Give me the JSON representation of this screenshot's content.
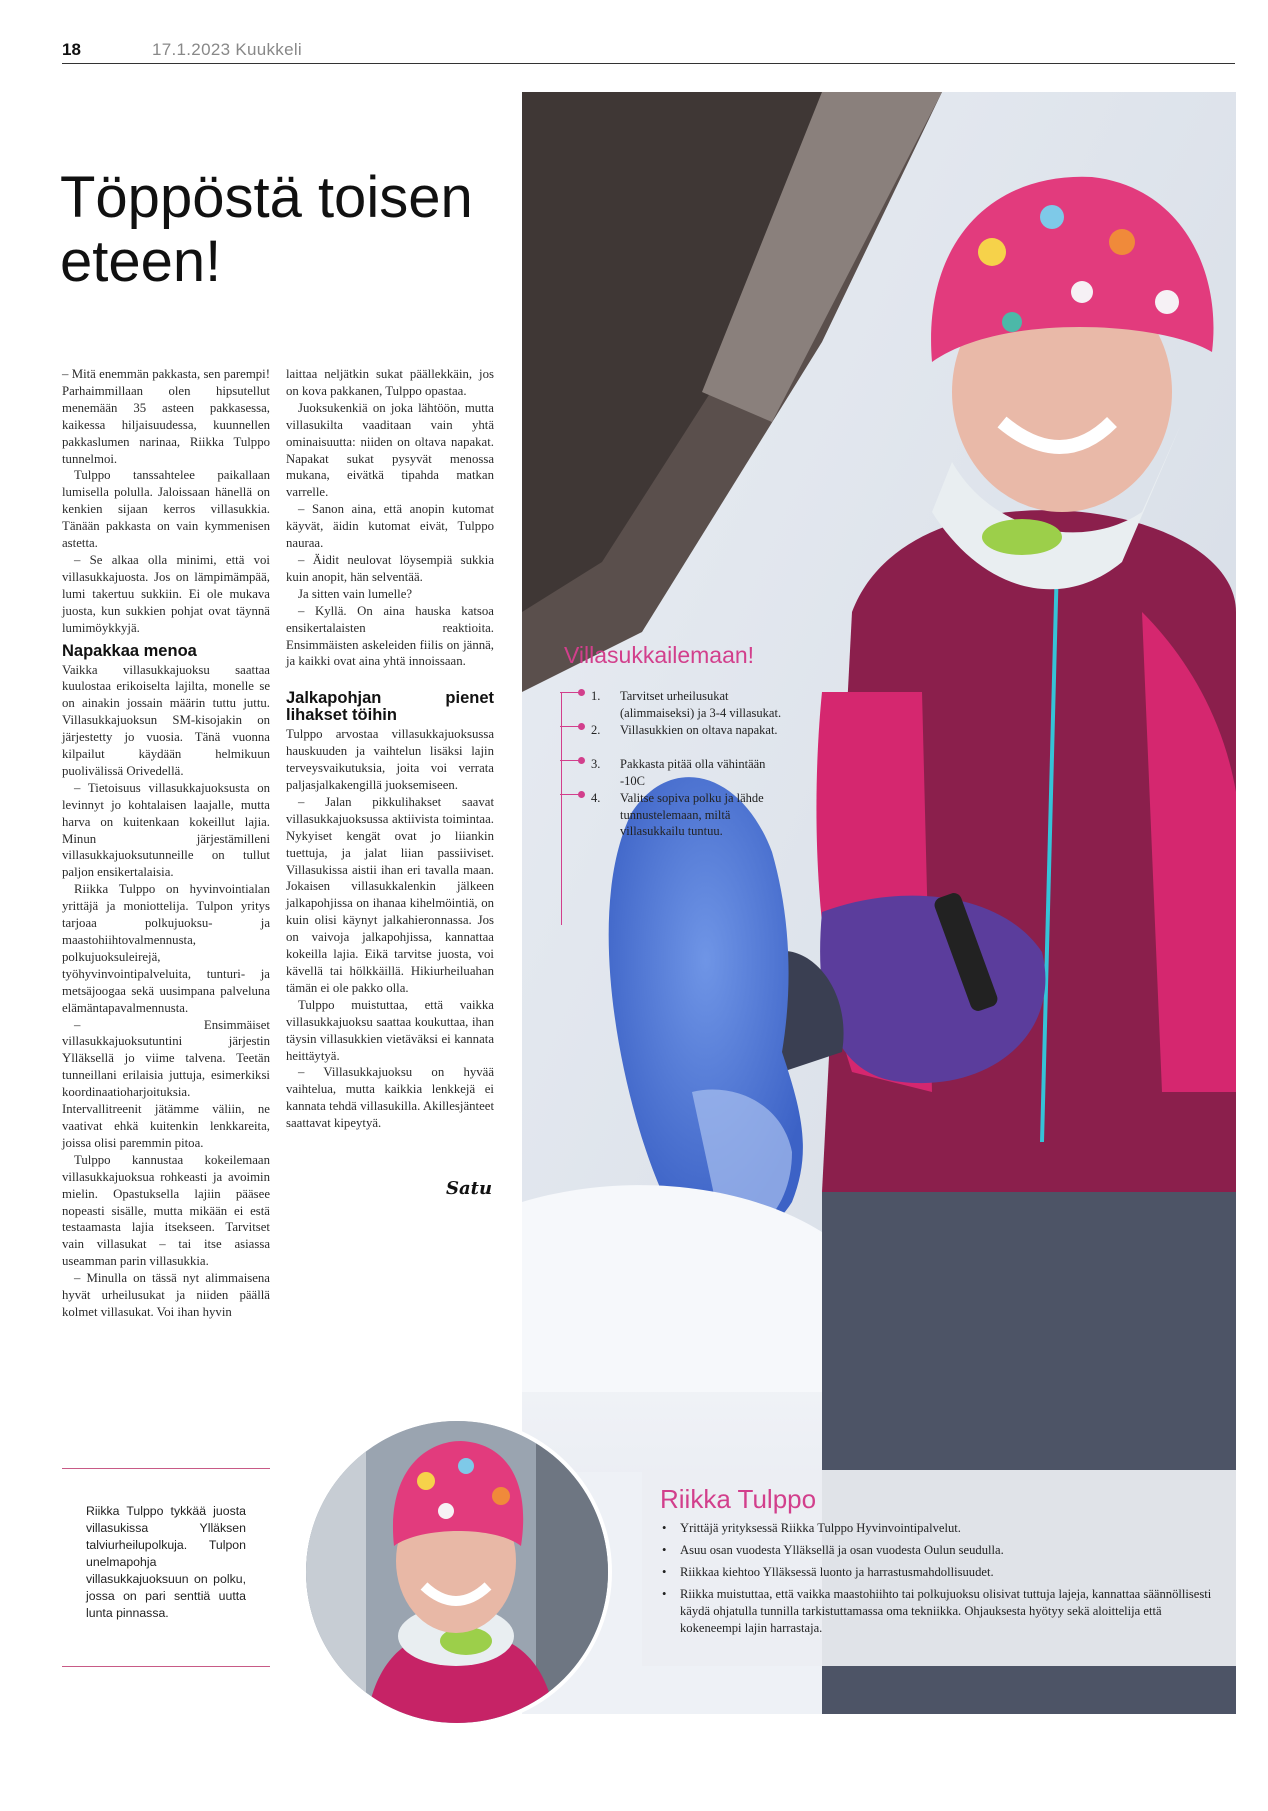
{
  "header": {
    "page_number": "18",
    "issue": "17.1.2023 Kuukkeli"
  },
  "title": "Töppöstä toisen eteen!",
  "col1": {
    "p1": "– Mitä enemmän pakkasta, sen parempi! Parhaimmillaan olen hipsutellut menemään 35 asteen pakkasessa, kaikessa hiljaisuudessa, kuunnellen pakkaslumen narinaa, Riikka Tulppo tunnelmoi.",
    "p2": "Tulppo tanssahtelee paikallaan lumisella polulla. Jaloissaan hänellä on kenkien sijaan kerros villasukkia. Tänään pakkasta on vain kymmenisen astetta.",
    "p3": "– Se alkaa olla minimi, että voi villasukkajuosta. Jos on lämpimämpää, lumi takertuu sukkiin. Ei ole mukava juosta, kun sukkien pohjat ovat täynnä lumimöykkyjä.",
    "h1": "Napakkaa menoa",
    "p4": "Vaikka villasukkajuoksu saattaa kuulostaa erikoiselta lajilta, monelle se on ainakin jossain määrin tuttu juttu. Villasukkajuoksun SM-kisojakin on järjestetty jo vuosia. Tänä vuonna kilpailut käydään helmikuun puolivälissä Orivedellä.",
    "p5": "– Tietoisuus villasukkajuoksusta on levinnyt jo kohtalaisen laajalle, mutta harva on kuitenkaan kokeillut lajia. Minun järjestämilleni villasukkajuoksutunneille on tullut paljon ensikertalaisia.",
    "p6": "Riikka Tulppo on hyvinvointialan yrittäjä ja moniottelija. Tulpon yritys tarjoaa polkujuoksu- ja maastohiihtovalmennusta, polkujuoksuleirejä, työhyvinvointipalveluita, tunturi- ja metsäjoogaa sekä uusimpana palveluna elämäntapavalmennusta.",
    "p7": "– Ensimmäiset villasukkajuoksutuntini järjestin Ylläksellä jo viime talvena. Teetän tunneillani erilaisia juttuja, esimerkiksi koordinaatioharjoituksia. Intervallitreenit jätämme väliin, ne vaativat ehkä kuitenkin lenkkareita, joissa olisi paremmin pitoa.",
    "p8": "Tulppo kannustaa kokeilemaan villasukkajuoksua rohkeasti ja avoimin mielin. Opastuksella lajiin pääsee nopeasti sisälle, mutta mikään ei estä testaamasta lajia itsekseen. Tarvitset vain villasukat – tai itse asiassa useamman parin villasukkia.",
    "p9": "– Minulla on tässä nyt alimmaisena hyvät urheilusukat ja niiden päällä kolmet villasukat. Voi ihan hyvin"
  },
  "col2": {
    "p1": "laittaa neljätkin sukat päällekkäin, jos on kova pakkanen, Tulppo opastaa.",
    "p2": "Juoksukenkiä on joka lähtöön, mutta villasukilta vaaditaan vain yhtä ominaisuutta: niiden on oltava napakat. Napakat sukat pysyvät menossa mukana, eivätkä tipahda matkan varrelle.",
    "p3": "– Sanon aina, että anopin kutomat käyvät, äidin kutomat eivät, Tulppo nauraa.",
    "p4": "– Äidit neulovat löysempiä sukkia kuin anopit, hän selventää.",
    "p5": "Ja sitten vain lumelle?",
    "p6": "– Kyllä. On aina hauska katsoa ensikertalaisten reaktioita. Ensimmäisten askeleiden fiilis on jännä, ja kaikki ovat aina yhtä innoissaan.",
    "h1": "Jalkapohjan pienet lihakset töihin",
    "p7": "Tulppo arvostaa villasukkajuoksussa hauskuuden ja vaihtelun lisäksi lajin terveysvaikutuksia, joita voi verrata paljasjalkakengillä juoksemiseen.",
    "p8": "– Jalan pikkulihakset saavat villasukkajuoksussa aktiivista toimintaa. Nykyiset kengät ovat jo liiankin tuettuja, ja jalat liian passiiviset. Villasukissa aistii ihan eri tavalla maan. Jokaisen villasukkalenkin jälkeen jalkapohjissa on ihanaa kihelmöintiä, on kuin olisi käynyt jalkahieronnassa. Jos on vaivoja jalkapohjissa, kannattaa kokeilla lajia. Eikä tarvitse juosta, voi kävellä tai hölkkäillä. Hikiurheiluahan tämän ei ole pakko olla.",
    "p9": "Tulppo muistuttaa, että vaikka villasukkajuoksu saattaa koukuttaa, ihan täysin villasukkien vietäväksi ei kannata heittäytyä.",
    "p10": "– Villasukkajuoksu on hyvää vaihtelua, mutta kaikkia lenkkejä ei kannata tehdä villasukilla. Akillesjänteet saattavat kipeytyä.",
    "signature": "Satu"
  },
  "infobox": {
    "title": "Villasukkailemaan!",
    "items": [
      {
        "num": "1.",
        "text": "Tarvitset urheilusukat (alimmaiseksi) ja 3-4 villasukat."
      },
      {
        "num": "2.",
        "text": "Villasukkien on oltava napakat."
      },
      {
        "num": "3.",
        "text": "Pakkasta pitää olla vähintään -10C"
      },
      {
        "num": "4.",
        "text": "Valitse sopiva polku ja lähde tunnustelemaan, miltä villasukkailu tuntuu."
      }
    ]
  },
  "caption": "Riikka Tulppo tykkää juosta villasukissa Ylläksen talviurheilupolkuja. Tulpon unelmapohja villasukkajuoksuun on polku, jossa on pari senttiä uutta lunta pinnassa.",
  "bio": {
    "name": "Riikka Tulppo",
    "items": [
      "Yrittäjä yrityksessä Riikka Tulppo Hyvinvointipalvelut.",
      "Asuu osan vuodesta Ylläksellä ja osan vuodesta Oulun seudulla.",
      "Riikkaa kiehtoo Ylläksessä luonto ja harrastusmahdollisuudet.",
      "Riikka muistuttaa, että vaikka maastohiihto tai polkujuoksu olisivat tuttuja lajeja, kannattaa säännöllisesti käydä ohjatulla tunnilla tarkistuttamassa oma tekniikka. Ohjauksesta hyötyy sekä aloittelija että kokeneempi lajin harrastaja."
    ]
  },
  "colors": {
    "accent": "#d23f8c",
    "rule": "#c85a86"
  }
}
